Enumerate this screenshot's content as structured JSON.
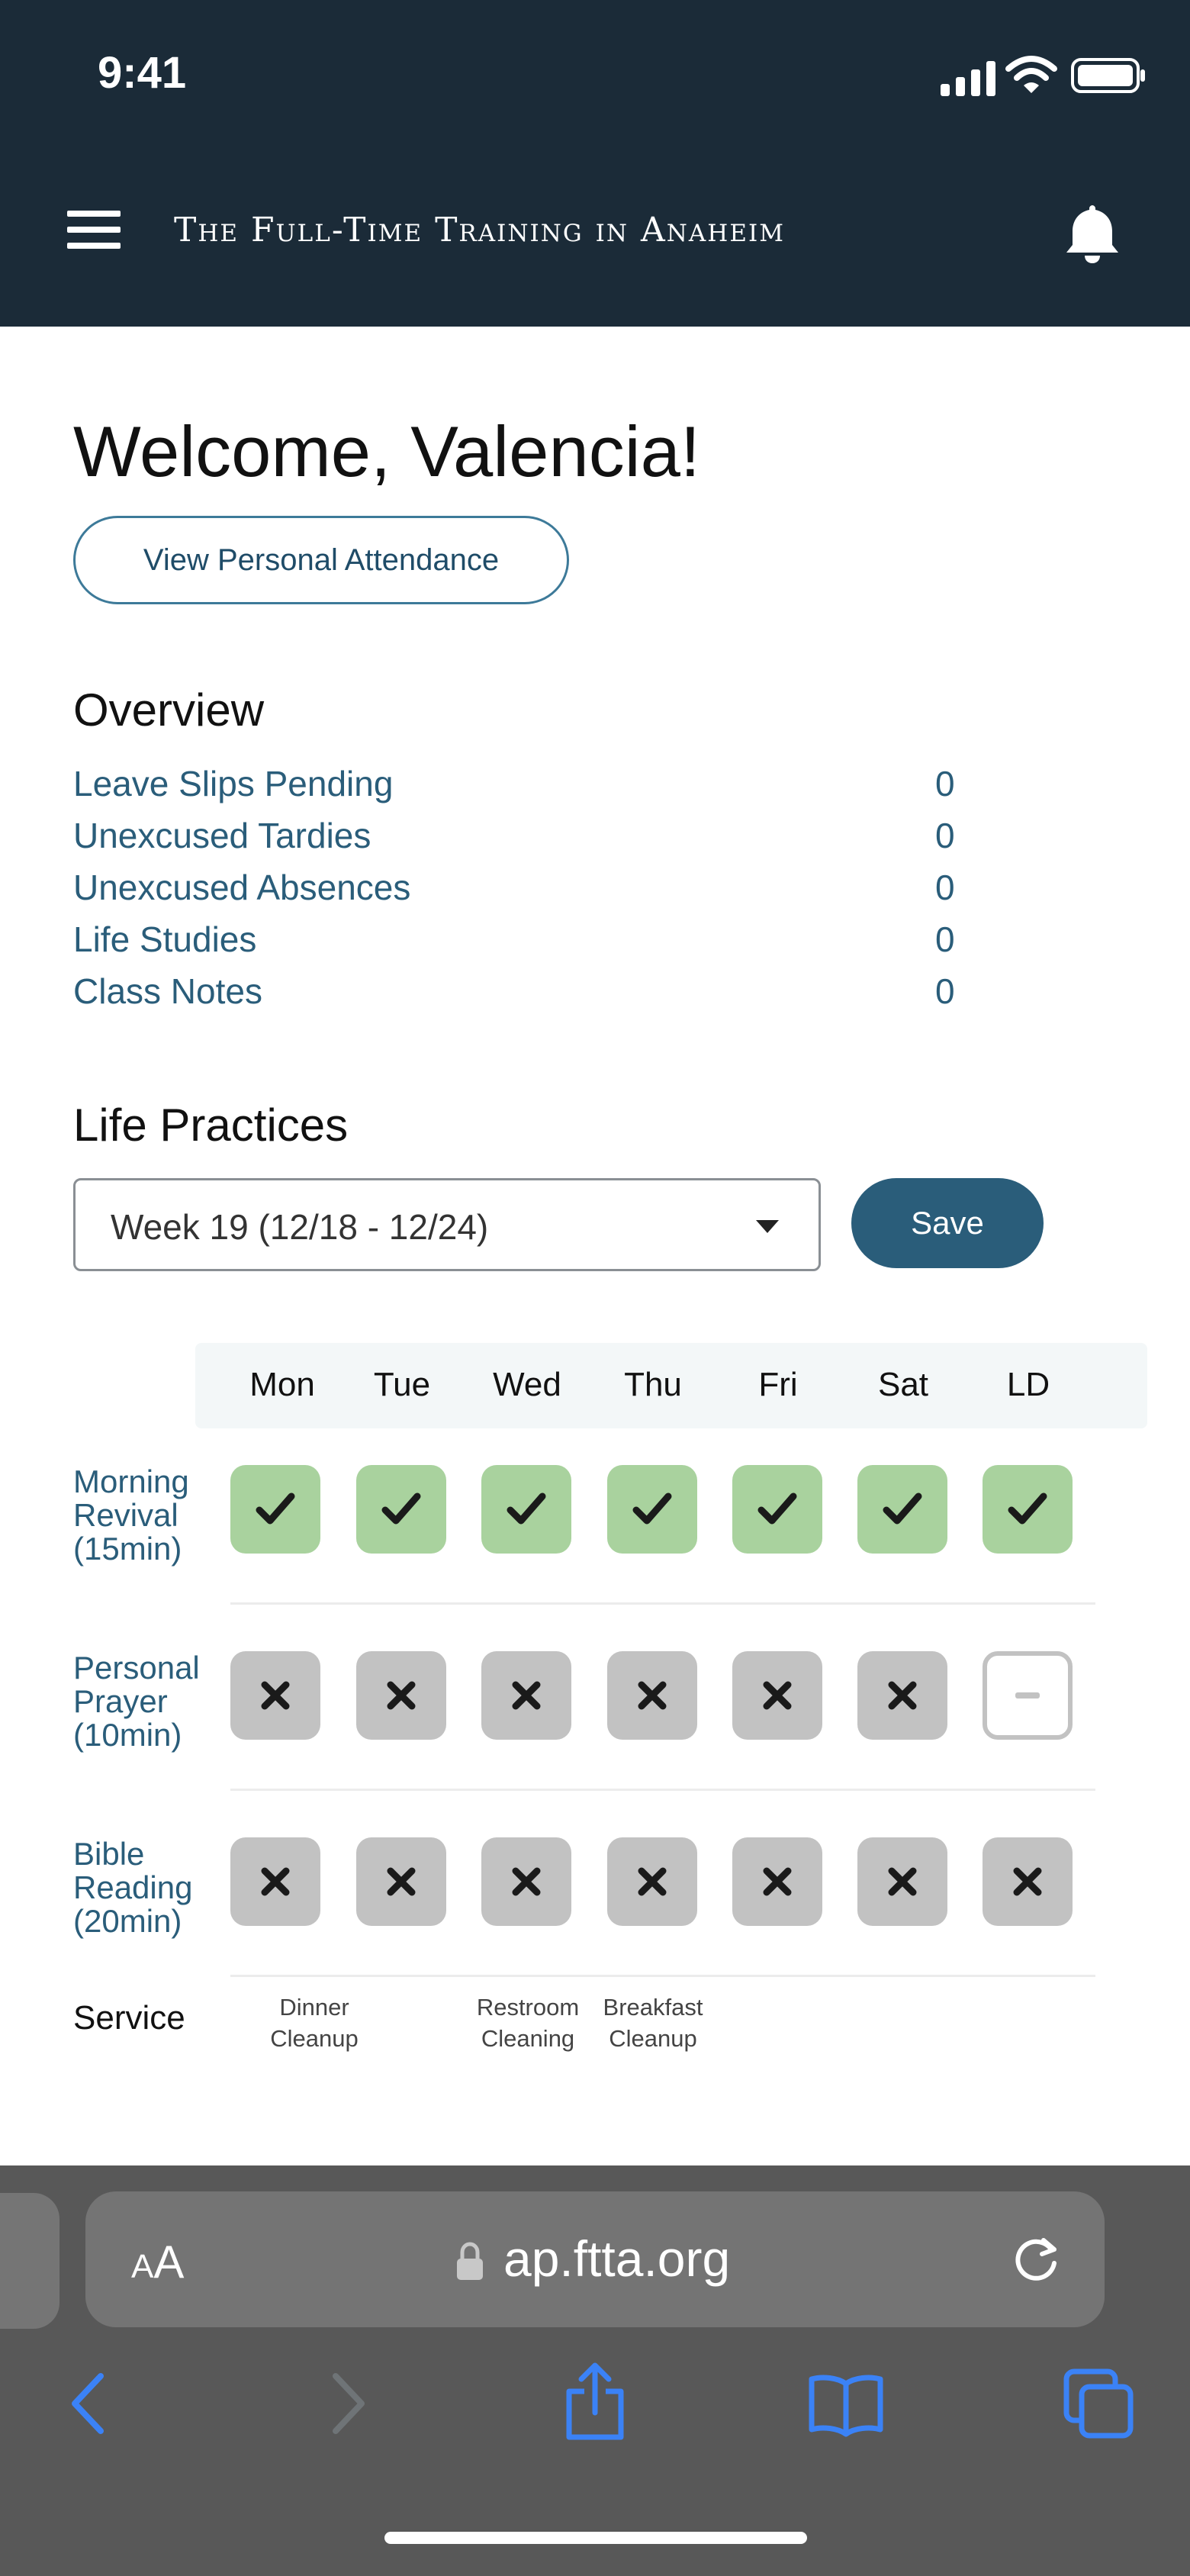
{
  "status_bar": {
    "time": "9:41"
  },
  "header": {
    "title": "The Full-Time Training in Anaheim"
  },
  "welcome": {
    "title": "Welcome, Valencia!",
    "attendance_button": "View Personal Attendance"
  },
  "overview": {
    "title": "Overview",
    "rows": [
      {
        "label": "Leave Slips Pending",
        "value": "0"
      },
      {
        "label": "Unexcused Tardies",
        "value": "0"
      },
      {
        "label": "Unexcused Absences",
        "value": "0"
      },
      {
        "label": "Life Studies",
        "value": "0"
      },
      {
        "label": "Class Notes",
        "value": "0"
      }
    ]
  },
  "life_practices": {
    "title": "Life Practices",
    "week_select": "Week 19 (12/18 - 12/24)",
    "save_label": "Save",
    "days": [
      "Mon",
      "Tue",
      "Wed",
      "Thu",
      "Fri",
      "Sat",
      "LD"
    ],
    "practices": [
      {
        "label_lines": [
          "Morning",
          "Revival",
          "(15min)"
        ],
        "status": [
          "done",
          "done",
          "done",
          "done",
          "done",
          "done",
          "done"
        ]
      },
      {
        "label_lines": [
          "Personal",
          "Prayer",
          "(10min)"
        ],
        "status": [
          "missed",
          "missed",
          "missed",
          "missed",
          "missed",
          "missed",
          "none"
        ]
      },
      {
        "label_lines": [
          "Bible",
          "Reading",
          "(20min)"
        ],
        "status": [
          "missed",
          "missed",
          "missed",
          "missed",
          "missed",
          "missed",
          "missed"
        ]
      }
    ],
    "service": {
      "label": "Service",
      "entries": [
        {
          "day": "Mon",
          "lines": [
            "Dinner",
            "Cleanup"
          ]
        },
        {
          "day": "Wed",
          "lines": [
            "Restroom",
            "Cleaning"
          ]
        },
        {
          "day": "Thu",
          "lines": [
            "Breakfast",
            "Cleanup"
          ]
        }
      ]
    }
  },
  "browser": {
    "aa_label": "AA",
    "url": "ap.ftta.org"
  },
  "colors": {
    "header_bg": "#1b2b38",
    "accent": "#2a5d7a",
    "done": "#a9d29e",
    "missed": "#c2c2c2",
    "safari_bar": "#585858"
  }
}
